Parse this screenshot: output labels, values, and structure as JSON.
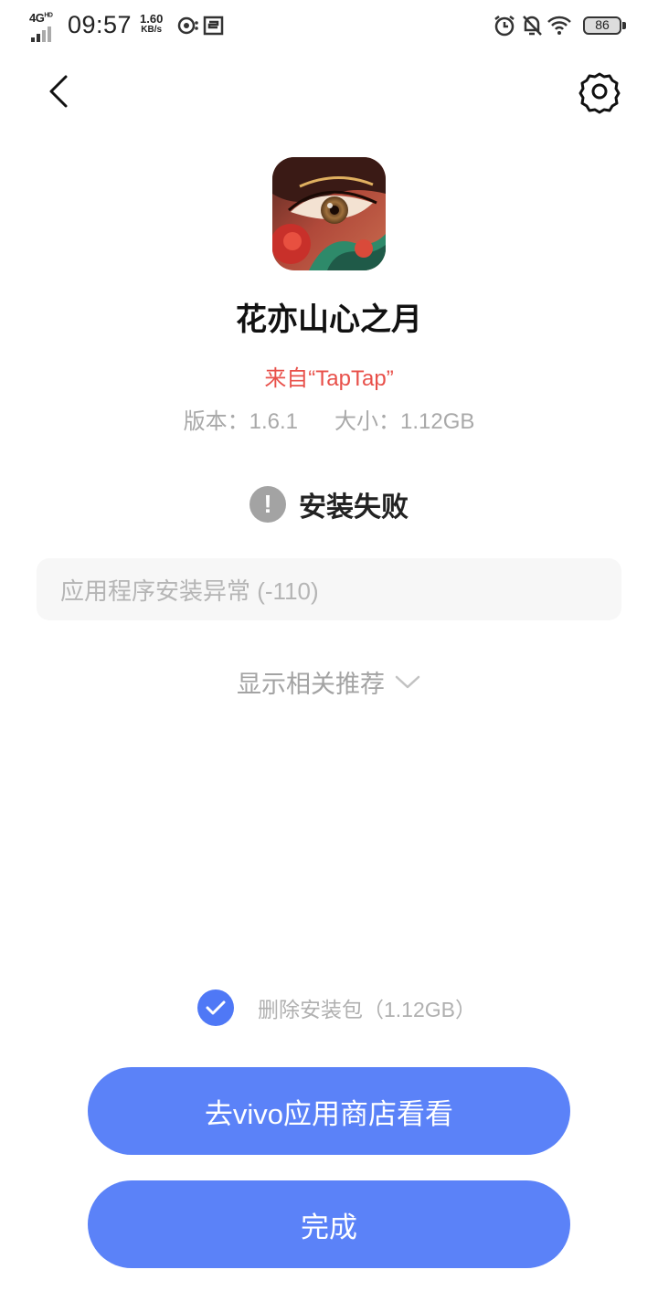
{
  "status_bar": {
    "network": "4G",
    "network_sup": "HD",
    "time": "09:57",
    "speed_value": "1.60",
    "speed_unit": "KB/s",
    "battery": "86"
  },
  "app": {
    "name": "花亦山心之月",
    "source": "来自“TapTap”",
    "version": "版本：1.6.1",
    "size": "大小：1.12GB"
  },
  "install": {
    "status": "安装失败",
    "status_icon": "exclamation-icon",
    "error_message": "应用程序安装异常 (-110)",
    "recommend_label": "显示相关推荐"
  },
  "options": {
    "delete_package_label": "删除安装包（1.12GB）",
    "delete_package_checked": true
  },
  "buttons": {
    "store_label": "去vivo应用商店看看",
    "done_label": "完成"
  },
  "colors": {
    "accent": "#5b82f8",
    "checkbox": "#4f78f6",
    "source_red": "#e8504a"
  }
}
